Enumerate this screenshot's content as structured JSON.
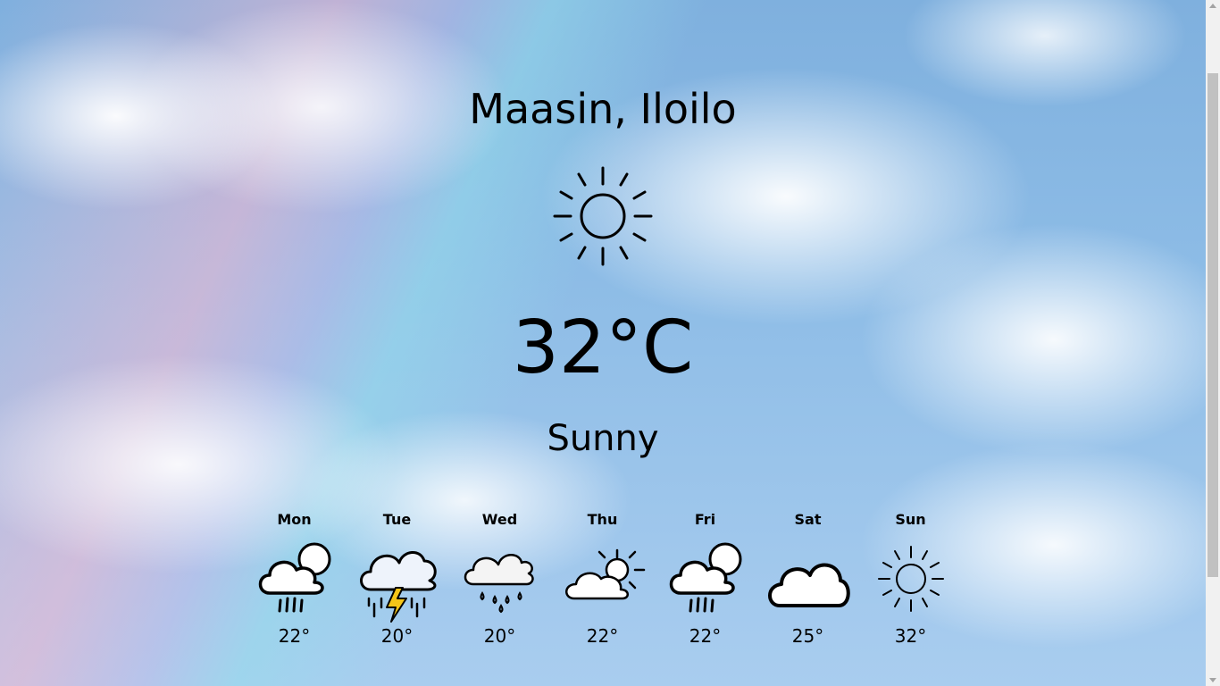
{
  "location": "Maasin, Iloilo",
  "current": {
    "temperature": "32°C",
    "condition": "Sunny",
    "icon": "sun-icon"
  },
  "forecast": [
    {
      "day": "Mon",
      "temp": "22°",
      "icon": "cloud-sun-rain-icon"
    },
    {
      "day": "Tue",
      "temp": "20°",
      "icon": "thunderstorm-icon"
    },
    {
      "day": "Wed",
      "temp": "20°",
      "icon": "cloud-sleet-icon"
    },
    {
      "day": "Thu",
      "temp": "22°",
      "icon": "partly-sunny-icon"
    },
    {
      "day": "Fri",
      "temp": "22°",
      "icon": "cloud-sun-rain-icon"
    },
    {
      "day": "Sat",
      "temp": "25°",
      "icon": "cloud-icon"
    },
    {
      "day": "Sun",
      "temp": "32°",
      "icon": "sun-icon"
    }
  ]
}
